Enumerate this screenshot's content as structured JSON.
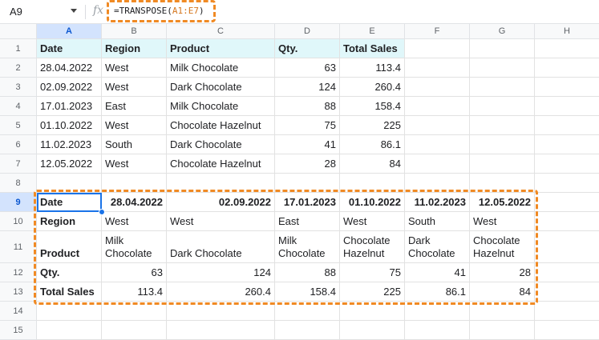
{
  "formula_bar": {
    "name_box": "A9",
    "fx_symbol": "fx",
    "formula_prefix": "=TRANSPOSE(",
    "formula_ref": "A1:E7",
    "formula_suffix": ")"
  },
  "columns": [
    "A",
    "B",
    "C",
    "D",
    "E",
    "F",
    "G",
    "H"
  ],
  "rows": [
    "1",
    "2",
    "3",
    "4",
    "5",
    "6",
    "7",
    "8",
    "9",
    "10",
    "11",
    "12",
    "13",
    "14",
    "15"
  ],
  "source_table": {
    "headers": [
      "Date",
      "Region",
      "Product",
      "Qty.",
      "Total Sales"
    ],
    "rows": [
      [
        "28.04.2022",
        "West",
        "Milk Chocolate",
        "63",
        "113.4"
      ],
      [
        "02.09.2022",
        "West",
        "Dark Chocolate",
        "124",
        "260.4"
      ],
      [
        "17.01.2023",
        "East",
        "Milk Chocolate",
        "88",
        "158.4"
      ],
      [
        "01.10.2022",
        "West",
        "Chocolate Hazelnut",
        "75",
        "225"
      ],
      [
        "11.02.2023",
        "South",
        "Dark Chocolate",
        "41",
        "86.1"
      ],
      [
        "12.05.2022",
        "West",
        "Chocolate Hazelnut",
        "28",
        "84"
      ]
    ]
  },
  "transposed_table": {
    "rows": [
      [
        "Date",
        "28.04.2022",
        "02.09.2022",
        "17.01.2023",
        "01.10.2022",
        "11.02.2023",
        "12.05.2022"
      ],
      [
        "Region",
        "West",
        "West",
        "East",
        "West",
        "South",
        "West"
      ],
      [
        "Product",
        "Milk Chocolate",
        "Dark Chocolate",
        "Milk Chocolate",
        "Chocolate Hazelnut",
        "Dark Chocolate",
        "Chocolate Hazelnut"
      ],
      [
        "Qty.",
        "63",
        "124",
        "88",
        "75",
        "41",
        "28"
      ],
      [
        "Total Sales",
        "113.4",
        "260.4",
        "158.4",
        "225",
        "86.1",
        "84"
      ]
    ]
  },
  "colors": {
    "highlight_orange": "#f08a24",
    "header_fill": "#e0f7fa",
    "selection_blue": "#1a73e8"
  }
}
